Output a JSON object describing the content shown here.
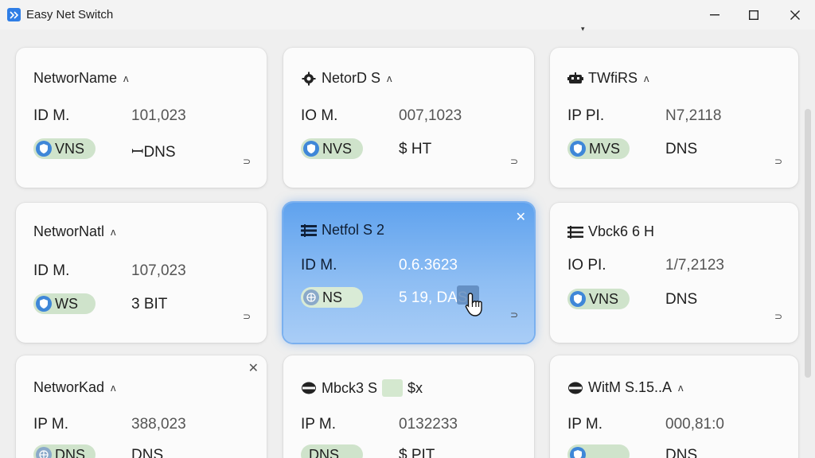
{
  "window": {
    "title": "Easy Net Switch",
    "minimize_label": "—",
    "maximize_label": "☐",
    "close_label": "✕"
  },
  "colors": {
    "accent": "#2f7ee6",
    "selected_card_top": "#5fa2ee",
    "pill_green": "#cfe3cb",
    "shield_blue": "#3f87d8"
  },
  "cards": [
    {
      "title": "NetworName",
      "title_icon": "none",
      "chevron": "ʌ",
      "row_label": "ID M.",
      "row_value": "101,023",
      "pill_text": "VNS",
      "pill_icon": "shield-icon",
      "dns_text": "ꟷDNS",
      "corner": "⊃",
      "close": ""
    },
    {
      "title": "NetorD S",
      "title_icon": "gear-icon",
      "chevron": "ʌ",
      "row_label": "IO M.",
      "row_value": "007,1023",
      "pill_text": "NVS",
      "pill_icon": "shield-icon",
      "dns_text": "$ HT",
      "corner": "⊃",
      "close": ""
    },
    {
      "title": "TWfiRS",
      "title_icon": "robot-icon",
      "chevron": "ʌ",
      "row_label": "IP PI.",
      "row_value": "N7,2118",
      "pill_text": "MVS",
      "pill_icon": "shield-icon",
      "dns_text": "DNS",
      "corner": "⊃",
      "close": ""
    },
    {
      "title": "NetworNatl",
      "title_icon": "none",
      "chevron": "ʌ",
      "row_label": "ID M.",
      "row_value": "107,023",
      "pill_text": "WS",
      "pill_icon": "shield-icon",
      "dns_text": "3 BIT",
      "corner": "⊃",
      "close": ""
    },
    {
      "title": "Netfol S 2",
      "title_icon": "list-icon",
      "chevron": "",
      "row_label": "ID M.",
      "row_value": "0.6.3623",
      "pill_text": "NS",
      "pill_icon": "globe-icon",
      "dns_text": "5 19, DAS",
      "corner": "⊃",
      "close": "✕"
    },
    {
      "title": "Vbck6 6 H",
      "title_icon": "list-icon",
      "chevron": "",
      "row_label": "IO PI.",
      "row_value": "1/7,2123",
      "pill_text": "VNS",
      "pill_icon": "shield-icon",
      "dns_text": "DNS",
      "corner": "⊃",
      "close": ""
    },
    {
      "title": "NetworKad",
      "title_icon": "none",
      "chevron": "ʌ",
      "row_label": "IP M.",
      "row_value": "388,023",
      "pill_text": "DNS",
      "pill_icon": "globe-icon",
      "dns_text": "DNS",
      "corner": "",
      "close": "✕"
    },
    {
      "title": "Mbck3 S",
      "title_suffix": "$x",
      "title_icon": "disk-icon",
      "chevron": "",
      "row_label": "IP M.",
      "row_value": "0132233",
      "pill_text": "DNS",
      "pill_icon": "none",
      "dns_text": "$ PIT",
      "corner": "",
      "close": ""
    },
    {
      "title": "WitM S.15..A",
      "title_icon": "disk-icon",
      "chevron": "ʌ",
      "row_label": "IP M.",
      "row_value": "000,81:0",
      "pill_text": "",
      "pill_icon": "shield-icon",
      "dns_text": "DNS",
      "corner": "",
      "close": ""
    }
  ]
}
